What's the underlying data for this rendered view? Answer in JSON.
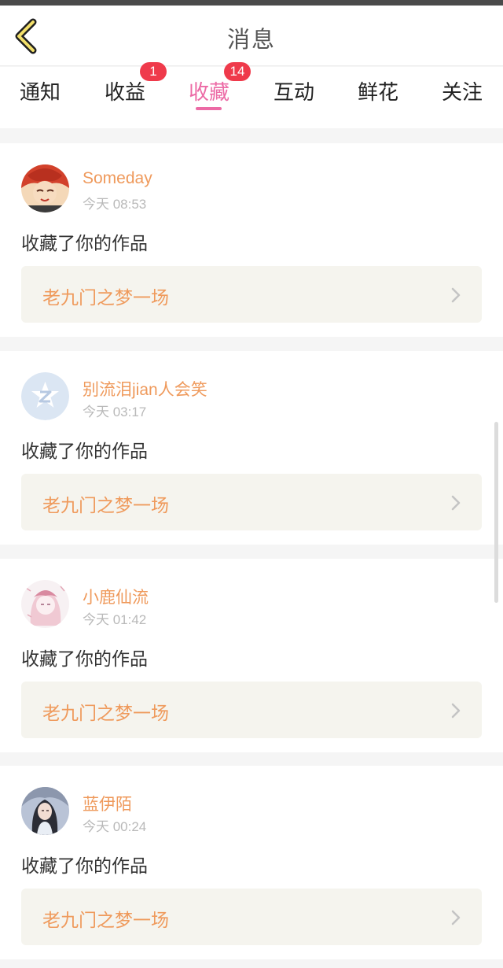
{
  "header": {
    "title": "消息",
    "back_icon": "chevron-left-icon"
  },
  "tabs": [
    {
      "label": "通知",
      "badge": ""
    },
    {
      "label": "收益",
      "badge": "1"
    },
    {
      "label": "收藏",
      "badge": "14",
      "active": true
    },
    {
      "label": "互动",
      "badge": ""
    },
    {
      "label": "鲜花",
      "badge": ""
    },
    {
      "label": "关注",
      "badge": ""
    }
  ],
  "colors": {
    "accent": "#ec6aa5",
    "badge": "#ef3a4b",
    "username": "#ef9a5c",
    "work_box_bg": "#f5f4ee"
  },
  "notifications": [
    {
      "username": "Someday",
      "time": "今天 08:53",
      "action": "收藏了你的作品",
      "work_title": "老九门之梦一场"
    },
    {
      "username": "别流泪jian人会笑",
      "time": "今天 03:17",
      "action": "收藏了你的作品",
      "work_title": "老九门之梦一场"
    },
    {
      "username": "小鹿仙流",
      "time": "今天 01:42",
      "action": "收藏了你的作品",
      "work_title": "老九门之梦一场"
    },
    {
      "username": "蓝伊陌",
      "time": "今天 00:24",
      "action": "收藏了你的作品",
      "work_title": "老九门之梦一场"
    }
  ]
}
